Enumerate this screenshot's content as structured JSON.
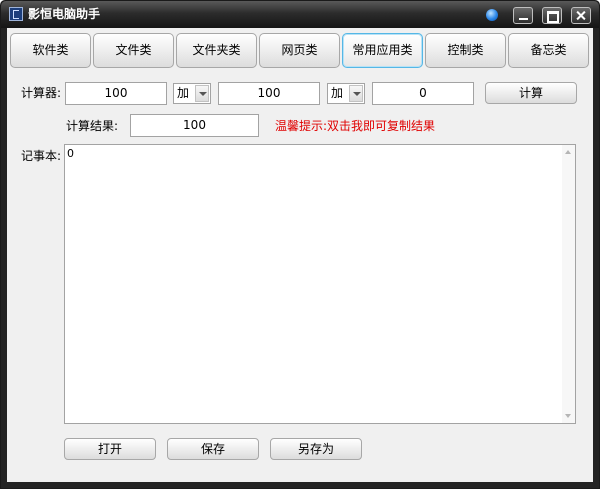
{
  "window": {
    "title": "影恒电脑助手"
  },
  "tabs": [
    {
      "label": "软件类"
    },
    {
      "label": "文件类"
    },
    {
      "label": "文件夹类"
    },
    {
      "label": "网页类"
    },
    {
      "label": "常用应用类",
      "active": true
    },
    {
      "label": "控制类"
    },
    {
      "label": "备忘类"
    }
  ],
  "calculator": {
    "label": "计算器:",
    "operand1": "100",
    "op1": "加",
    "operand2": "100",
    "op2": "加",
    "operand3": "0",
    "calc_button": "计算",
    "result_label": "计算结果:",
    "result_value": "100",
    "hint": "温馨提示:双击我即可复制结果"
  },
  "notepad": {
    "label": "记事本:",
    "content": "0"
  },
  "buttons": {
    "open": "打开",
    "save": "保存",
    "save_as": "另存为"
  },
  "colors": {
    "hint": "#e00000",
    "active_tab_border": "#55b7e6",
    "titlebar": "#2c2c2c"
  },
  "icons": {
    "app": "app-icon",
    "pin": "pin-icon",
    "minimize": "minimize-icon",
    "maximize": "maximize-icon",
    "close": "close-icon"
  }
}
